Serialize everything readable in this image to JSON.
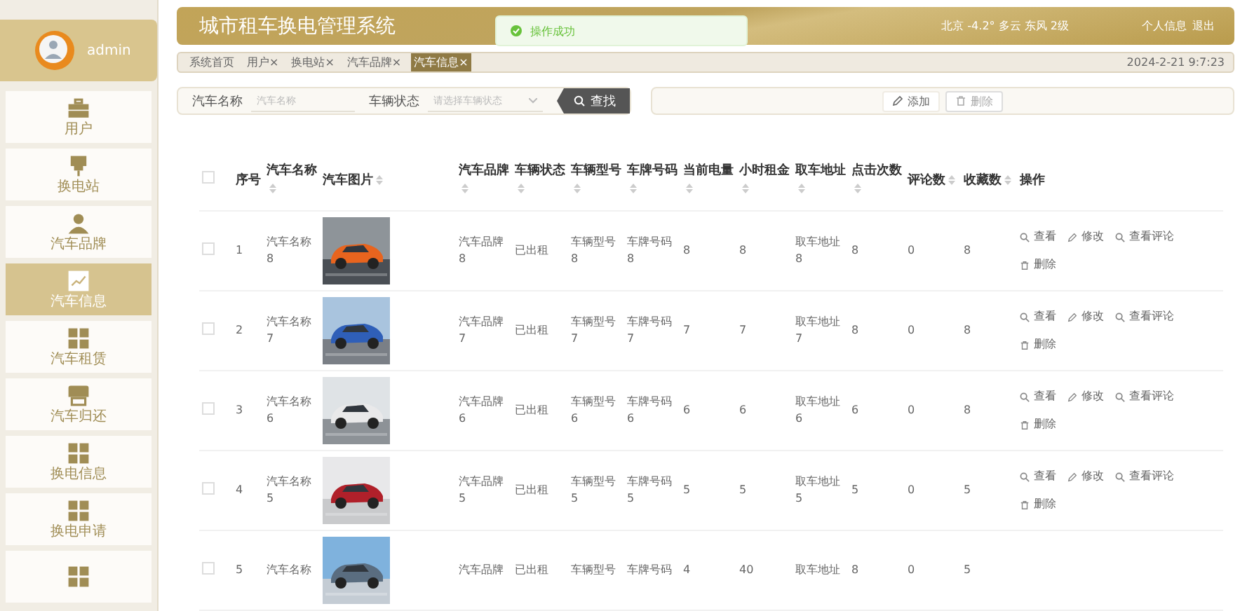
{
  "sidebar": {
    "user": {
      "name": "admin"
    },
    "items": [
      {
        "label": "用户",
        "kind": "briefcase",
        "selected": false
      },
      {
        "label": "换电站",
        "kind": "plug",
        "selected": false
      },
      {
        "label": "汽车品牌",
        "kind": "person",
        "selected": false
      },
      {
        "label": "汽车信息",
        "kind": "chart",
        "selected": true
      },
      {
        "label": "汽车租赁",
        "kind": "grid",
        "selected": false
      },
      {
        "label": "汽车归还",
        "kind": "store",
        "selected": false
      },
      {
        "label": "换电信息",
        "kind": "grid",
        "selected": false
      },
      {
        "label": "换电申请",
        "kind": "grid",
        "selected": false
      },
      {
        "kind": "grid",
        "selected": false
      }
    ]
  },
  "header": {
    "title": "城市租车换电管理系统",
    "weather": "北京  -4.2°  多云  东风  2级",
    "links": [
      "个人信息",
      "退出"
    ]
  },
  "toast": {
    "kind": "success",
    "text": "操作成功"
  },
  "tabs": [
    {
      "label": "系统首页",
      "selected": false
    },
    {
      "label": "用户×",
      "selected": false
    },
    {
      "label": "换电站×",
      "selected": false
    },
    {
      "label": "汽车品牌×",
      "selected": false
    },
    {
      "label": "汽车信息×",
      "selected": true
    }
  ],
  "datetime": "2024-2-21 9:7:23",
  "search": {
    "fields": [
      {
        "kind": "input",
        "label": "汽车名称",
        "placeholder": "汽车名称"
      },
      {
        "kind": "select",
        "label": "车辆状态",
        "placeholder": "请选择车辆状态"
      }
    ],
    "button": "查找"
  },
  "buttons": [
    {
      "label": "添加",
      "kind": "add",
      "disabled": false
    },
    {
      "label": "删除",
      "kind": "delete",
      "disabled": true
    }
  ],
  "table": {
    "select_all_checked": false,
    "columns": [
      {
        "label": "序号",
        "sortable": false
      },
      {
        "label": "汽车名称",
        "sortable": true
      },
      {
        "label": "汽车图片",
        "sortable": true
      },
      {
        "label": "汽车品牌",
        "sortable": true
      },
      {
        "label": "车辆状态",
        "sortable": true
      },
      {
        "label": "车辆型号",
        "sortable": true
      },
      {
        "label": "车牌号码",
        "sortable": true
      },
      {
        "label": "当前电量",
        "sortable": true
      },
      {
        "label": "小时租金",
        "sortable": true
      },
      {
        "label": "取车地址",
        "sortable": true
      },
      {
        "label": "点击次数",
        "sortable": true
      },
      {
        "label": "评论数",
        "sortable": true
      },
      {
        "label": "收藏数",
        "sortable": true
      },
      {
        "label": "操作",
        "sortable": false
      }
    ],
    "rows": [
      {
        "checked": false,
        "cells": [
          "1",
          "汽车名称\n8",
          {
            "kind": "picture"
          },
          "汽车品牌\n8",
          "已出租",
          "车辆型号\n8",
          "车牌号码\n8",
          "8",
          "8",
          "取车地址\n8",
          "8",
          "0",
          "8"
        ],
        "actions": [
          {
            "label": "查看",
            "kind": "view"
          },
          {
            "label": "修改",
            "kind": "edit"
          },
          {
            "label": "查看评论",
            "kind": "view"
          },
          {
            "label": "删除",
            "kind": "delete"
          }
        ]
      },
      {
        "checked": false,
        "cells": [
          "2",
          "汽车名称\n7",
          {
            "kind": "picture"
          },
          "汽车品牌\n7",
          "已出租",
          "车辆型号\n7",
          "车牌号码\n7",
          "7",
          "7",
          "取车地址\n7",
          "8",
          "0",
          "8"
        ],
        "actions": [
          {
            "label": "查看",
            "kind": "view"
          },
          {
            "label": "修改",
            "kind": "edit"
          },
          {
            "label": "查看评论",
            "kind": "view"
          },
          {
            "label": "删除",
            "kind": "delete"
          }
        ]
      },
      {
        "checked": false,
        "cells": [
          "3",
          "汽车名称\n6",
          {
            "kind": "picture"
          },
          "汽车品牌\n6",
          "已出租",
          "车辆型号\n6",
          "车牌号码\n6",
          "6",
          "6",
          "取车地址\n6",
          "6",
          "0",
          "8"
        ],
        "actions": [
          {
            "label": "查看",
            "kind": "view"
          },
          {
            "label": "修改",
            "kind": "edit"
          },
          {
            "label": "查看评论",
            "kind": "view"
          },
          {
            "label": "删除",
            "kind": "delete"
          }
        ]
      },
      {
        "checked": false,
        "cells": [
          "4",
          "汽车名称\n5",
          {
            "kind": "picture"
          },
          "汽车品牌\n5",
          "已出租",
          "车辆型号\n5",
          "车牌号码\n5",
          "5",
          "5",
          "取车地址\n5",
          "5",
          "0",
          "5"
        ],
        "actions": [
          {
            "label": "查看",
            "kind": "view"
          },
          {
            "label": "修改",
            "kind": "edit"
          },
          {
            "label": "查看评论",
            "kind": "view"
          },
          {
            "label": "删除",
            "kind": "delete"
          }
        ]
      },
      {
        "checked": false,
        "cells": [
          "5",
          "汽车名称",
          {
            "kind": "picture"
          },
          "汽车品牌",
          "已出租",
          "车辆型号",
          "车牌号码",
          "4",
          "40",
          "取车地址",
          "8",
          "0",
          "5"
        ],
        "actions": []
      }
    ]
  }
}
